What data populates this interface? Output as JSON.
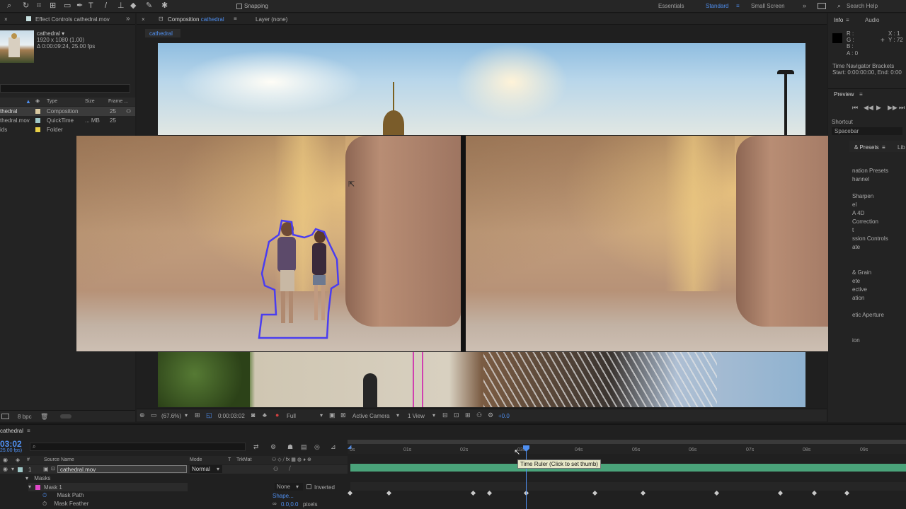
{
  "toolbar": {
    "snapping": "Snapping",
    "workspaces": [
      "Essentials",
      "Standard",
      "Small Screen"
    ],
    "search_placeholder": "Search Help"
  },
  "project": {
    "tab": "Effect Controls cathedral.mov",
    "item_name": "cathedral ▾",
    "item_dims": "1920 x 1080 (1.00)",
    "item_dur": "Δ 0:00:09:24, 25.00 fps",
    "col_type": "Type",
    "col_size": "Size",
    "col_frame": "Frame ...",
    "items": [
      {
        "name": "thedral",
        "type": "Composition",
        "size": "",
        "frame": "25",
        "color": "#d8c8a0"
      },
      {
        "name": "thedral.mov",
        "type": "QuickTime",
        "size": "... MB",
        "frame": "25",
        "color": "#9fc8c8"
      },
      {
        "name": "ids",
        "type": "Folder",
        "size": "",
        "frame": "",
        "color": "#e8d048"
      }
    ],
    "bpc": "8 bpc"
  },
  "composition": {
    "tab": "Composition",
    "tab_name": "cathedral",
    "layer_tab": "Layer (none)",
    "sub_tab": "cathedral",
    "zoom": "(67.6%)",
    "timecode": "0:00:03:02",
    "resolution": "Full",
    "camera": "Active Camera",
    "views": "1 View",
    "exposure": "+0.0"
  },
  "info": {
    "tab": "Info",
    "tab2": "Audio",
    "r": "R :",
    "g": "G :",
    "b": "B :",
    "a": "A : 0",
    "x": "X : 1",
    "y": "Y : 72",
    "nav_label": "Time Navigator Brackets",
    "nav_value": "Start: 0:00:00:00, End: 0:00"
  },
  "preview": {
    "tab": "Preview",
    "shortcut": "Shortcut",
    "spacebar": "Spacebar"
  },
  "effects": {
    "tab": "& Presets",
    "tab2": "Lib",
    "items": [
      "nation Presets",
      "hannel",
      "",
      "Sharpen",
      "el",
      "A 4D",
      "Correction",
      "t",
      "ssion Controls",
      "ate",
      "",
      "",
      "& Grain",
      "ete",
      "ective",
      "ation",
      "",
      "etic Aperture",
      "",
      "",
      "ion"
    ]
  },
  "timeline": {
    "comp_name": "cathedral",
    "timecode": "03:02",
    "fps": "25.00 fps)",
    "col_source": "Source Name",
    "col_mode": "Mode",
    "col_t": "T",
    "col_trkmat": "TrkMat",
    "layer_num": "1",
    "layer_name": "cathedral.mov",
    "layer_mode": "Normal",
    "masks": "Masks",
    "mask1": "Mask 1",
    "mask_path": "Mask Path",
    "mask_feather": "Mask Feather",
    "mask_mode": "None",
    "inverted": "Inverted",
    "shape": "Shape...",
    "feather_value": "0.0,0.0",
    "feather_unit": "pixels",
    "ticks": [
      "0s",
      "01s",
      "02s",
      "03s",
      "04s",
      "05s",
      "06s",
      "07s",
      "08s",
      "09s"
    ],
    "tooltip": "Time Ruler (Click to set thumb)"
  }
}
